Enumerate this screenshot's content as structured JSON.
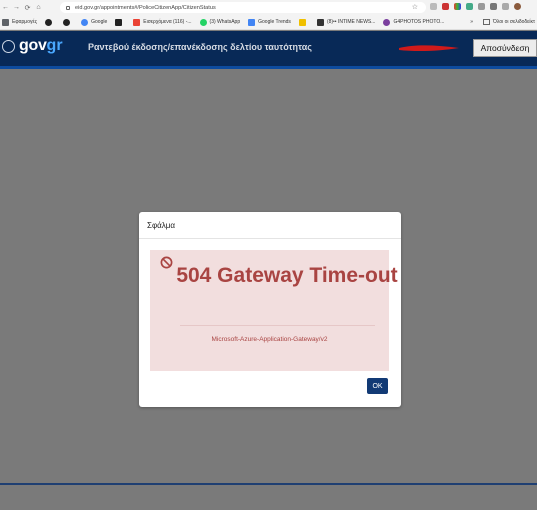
{
  "browser": {
    "url": "eid.gov.gr/appointments#/PoliceCitizenApp/CitizenStatus",
    "bookmarks": [
      {
        "label": "Εφαρμογές",
        "icon": "apps-icon",
        "color": "#5f6368"
      },
      {
        "label": "",
        "icon": "github-icon",
        "color": "#222222"
      },
      {
        "label": "",
        "icon": "github-icon",
        "color": "#222222"
      },
      {
        "label": "Google",
        "icon": "google-icon",
        "color": "#4285f4"
      },
      {
        "label": "",
        "icon": "youtube-icon",
        "color": "#222222"
      },
      {
        "label": "Εισερχόμενα (116) -...",
        "icon": "gmail-icon",
        "color": "#ea4335"
      },
      {
        "label": "(3) WhatsApp",
        "icon": "whatsapp-icon",
        "color": "#25d366"
      },
      {
        "label": "Google Trends",
        "icon": "trends-icon",
        "color": "#4285f4"
      },
      {
        "label": "",
        "icon": "v-icon",
        "color": "#f0c000"
      },
      {
        "label": "(8)•• INTIME NEWS...",
        "icon": "news-icon",
        "color": "#333333"
      },
      {
        "label": "G4PHOTOS PHOTO...",
        "icon": "photo-icon",
        "color": "#7a3f9e"
      }
    ],
    "more": "»",
    "all_bookmarks": "Όλοι οι σελιδοδείκτ"
  },
  "header": {
    "logo_gov": "gov",
    "logo_gr": "gr",
    "title": "Ραντεβού έκδοσης/επανέκδοσης δελτίου ταυτότητας",
    "logout": "Αποσύνδεση"
  },
  "dialog": {
    "title": "Σφάλμα",
    "error_title": "504 Gateway Time-out",
    "error_subtitle": "Microsoft-Azure-Application-Gateway/v2",
    "ok": "OK"
  },
  "colors": {
    "header_bg": "#082957",
    "error_bg": "#f2dede",
    "error_text": "#a94442",
    "ok_bg": "#123a75"
  }
}
